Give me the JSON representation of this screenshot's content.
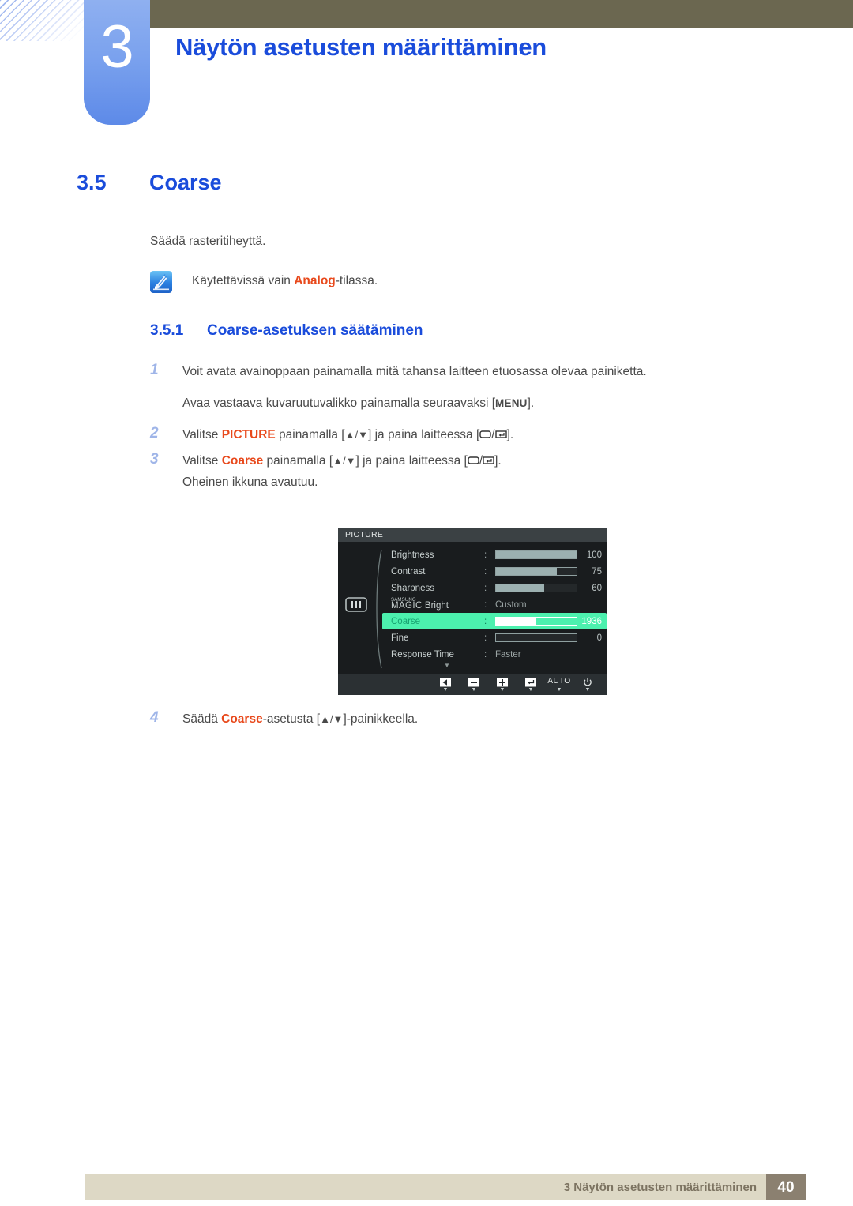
{
  "header": {
    "chapter_number": "3",
    "chapter_title": "Näytön asetusten määrittäminen",
    "olive_color": "#6b6750",
    "tab_color": "#6d99ec",
    "title_color": "#1a4cdb"
  },
  "section": {
    "number": "3.5",
    "title": "Coarse",
    "intro": "Säädä rasteritiheyttä."
  },
  "note": {
    "icon": "note-pencil-icon",
    "text_before": "Käytettävissä vain ",
    "highlight": "Analog",
    "text_after": "-tilassa.",
    "highlight_color": "#e8491c"
  },
  "subsection": {
    "number": "3.5.1",
    "title": "Coarse-asetuksen säätäminen"
  },
  "steps": [
    {
      "num": "1",
      "text": "Voit avata avainoppaan painamalla mitä tahansa laitteen etuosassa olevaa painiketta.",
      "continuation_prefix": "Avaa vastaava kuvaruutuvalikko painamalla seuraavaksi [",
      "continuation_key": "MENU",
      "continuation_suffix": "]."
    },
    {
      "num": "2",
      "prefix": "Valitse ",
      "emphasis": "PICTURE",
      "middle": " painamalla [",
      "arrows": "▲/▼",
      "tail": "] ja paina laitteessa [",
      "tail2": "/",
      "tail3": "]."
    },
    {
      "num": "3",
      "prefix": "Valitse ",
      "emphasis": "Coarse",
      "middle": " painamalla [",
      "arrows": "▲/▼",
      "tail": "] ja paina laitteessa [",
      "tail2": "/",
      "tail3": "].",
      "continuation": "Oheinen ikkuna avautuu."
    },
    {
      "num": "4",
      "prefix": "Säädä ",
      "emphasis": "Coarse",
      "middle": "-asetusta [",
      "arrows": "▲/▼",
      "tail": "]-painikkeella."
    }
  ],
  "osd": {
    "title": "PICTURE",
    "side_icon": "picture-bars-icon",
    "rows": [
      {
        "label": "Brightness",
        "type": "bar",
        "value": "100",
        "fill_pct": 100
      },
      {
        "label": "Contrast",
        "type": "bar",
        "value": "75",
        "fill_pct": 75
      },
      {
        "label": "Sharpness",
        "type": "bar",
        "value": "60",
        "fill_pct": 60
      },
      {
        "label_small": "SAMSUNG",
        "label_main": "MAGIC",
        "label_suffix": " Bright",
        "type": "text",
        "value": "Custom"
      },
      {
        "label": "Coarse",
        "type": "bar",
        "value": "1936",
        "fill_pct": 50,
        "selected": true
      },
      {
        "label": "Fine",
        "type": "bar",
        "value": "0",
        "fill_pct": 0
      },
      {
        "label": "Response Time",
        "type": "text",
        "value": "Faster"
      }
    ],
    "scroll_down_glyph": "▼",
    "buttons": [
      {
        "name": "back",
        "glyph": "◀",
        "sub": "▼"
      },
      {
        "name": "minus",
        "glyph": "▬",
        "sub": "▼"
      },
      {
        "name": "plus",
        "glyph": "✚",
        "sub": "▼"
      },
      {
        "name": "enter",
        "glyph": "↵",
        "sub": "▼"
      },
      {
        "name": "auto",
        "glyph": "AUTO",
        "sub": "▼"
      },
      {
        "name": "power",
        "glyph": "⏻",
        "sub": "▼"
      }
    ],
    "highlight_color": "#4cf0ae",
    "bar_fill_color": "#9cb0b0"
  },
  "footer": {
    "text": "3 Näytön asetusten määrittäminen",
    "page": "40",
    "bar_color": "#ddd8c5",
    "page_box_color": "#8b8070"
  }
}
